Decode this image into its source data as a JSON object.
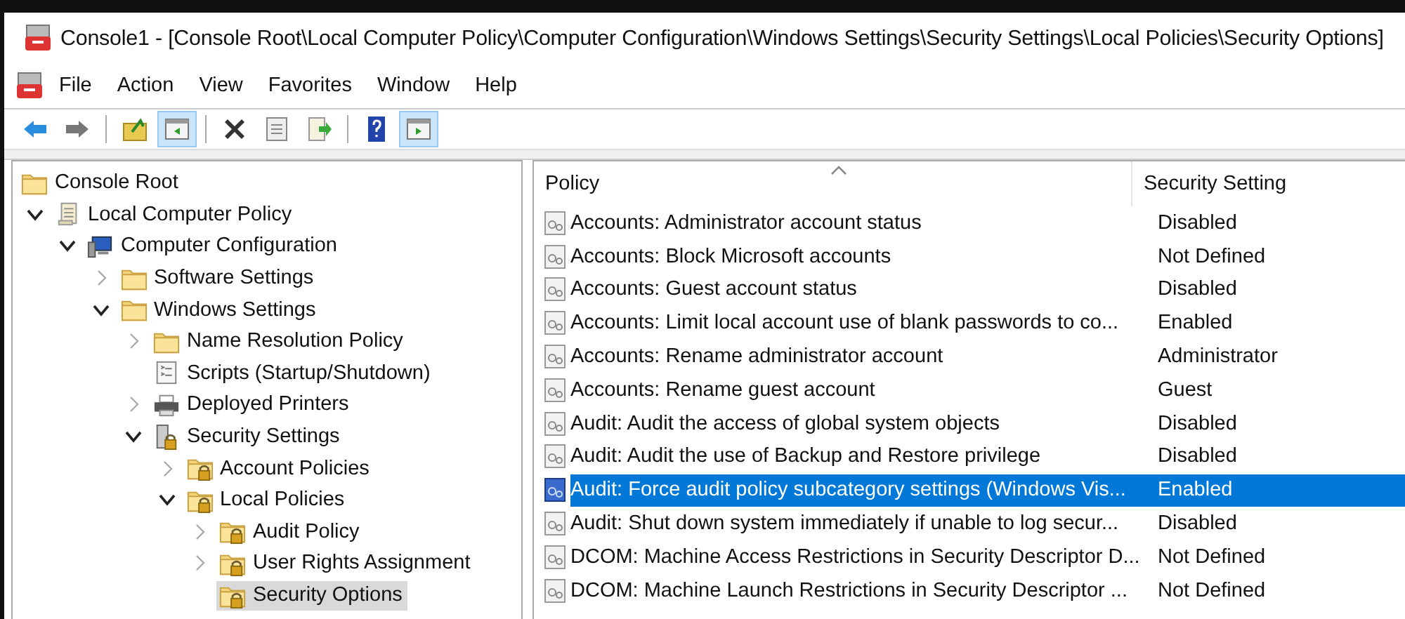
{
  "window": {
    "title": "Console1 - [Console Root\\Local Computer Policy\\Computer Configuration\\Windows Settings\\Security Settings\\Local Policies\\Security Options]"
  },
  "menu": [
    "File",
    "Action",
    "View",
    "Favorites",
    "Window",
    "Help"
  ],
  "toolbar": [
    {
      "kind": "back",
      "pressed": false
    },
    {
      "kind": "forward",
      "pressed": false
    },
    {
      "kind": "sep"
    },
    {
      "kind": "up",
      "pressed": false
    },
    {
      "kind": "tree",
      "pressed": true
    },
    {
      "kind": "sep"
    },
    {
      "kind": "delete",
      "pressed": false
    },
    {
      "kind": "properties",
      "pressed": false
    },
    {
      "kind": "export",
      "pressed": false
    },
    {
      "kind": "sep"
    },
    {
      "kind": "help",
      "pressed": false
    },
    {
      "kind": "actionpane",
      "pressed": true
    }
  ],
  "tree": [
    {
      "label": "Console Root",
      "kind": "folder",
      "selected": false,
      "children": [
        {
          "label": "Local Computer Policy",
          "kind": "scroll",
          "expandable": true,
          "expanded": true,
          "selected": false,
          "children": [
            {
              "label": "Computer Configuration",
              "kind": "computer",
              "expandable": true,
              "expanded": true,
              "selected": false,
              "children": [
                {
                  "label": "Software Settings",
                  "kind": "folder",
                  "expandable": true,
                  "expanded": false,
                  "selected": false
                },
                {
                  "label": "Windows Settings",
                  "kind": "folder",
                  "expandable": true,
                  "expanded": true,
                  "selected": false,
                  "children": [
                    {
                      "label": "Name Resolution Policy",
                      "kind": "folder",
                      "expandable": true,
                      "expanded": false,
                      "selected": false
                    },
                    {
                      "label": "Scripts (Startup/Shutdown)",
                      "kind": "script",
                      "selected": false
                    },
                    {
                      "label": "Deployed Printers",
                      "kind": "printer",
                      "expandable": true,
                      "expanded": false,
                      "selected": false
                    },
                    {
                      "label": "Security Settings",
                      "kind": "security",
                      "expandable": true,
                      "expanded": true,
                      "selected": false,
                      "children": [
                        {
                          "label": "Account Policies",
                          "kind": "lockfolder",
                          "expandable": true,
                          "expanded": false,
                          "selected": false
                        },
                        {
                          "label": "Local Policies",
                          "kind": "lockfolder",
                          "expandable": true,
                          "expanded": true,
                          "selected": false,
                          "children": [
                            {
                              "label": "Audit Policy",
                              "kind": "lockfolder",
                              "expandable": true,
                              "expanded": false,
                              "selected": false
                            },
                            {
                              "label": "User Rights Assignment",
                              "kind": "lockfolder",
                              "expandable": true,
                              "expanded": false,
                              "selected": false
                            },
                            {
                              "label": "Security Options",
                              "kind": "lockfolder",
                              "selected": true
                            }
                          ]
                        }
                      ]
                    }
                  ]
                }
              ]
            }
          ]
        }
      ]
    }
  ],
  "table": {
    "columns": [
      "Policy",
      "Security Setting"
    ],
    "rows": [
      {
        "policy": "Accounts: Administrator account status",
        "setting": "Disabled",
        "selected": false
      },
      {
        "policy": "Accounts: Block Microsoft accounts",
        "setting": "Not Defined",
        "selected": false
      },
      {
        "policy": "Accounts: Guest account status",
        "setting": "Disabled",
        "selected": false
      },
      {
        "policy": "Accounts: Limit local account use of blank passwords to co...",
        "setting": "Enabled",
        "selected": false
      },
      {
        "policy": "Accounts: Rename administrator account",
        "setting": "Administrator",
        "selected": false
      },
      {
        "policy": "Accounts: Rename guest account",
        "setting": "Guest",
        "selected": false
      },
      {
        "policy": "Audit: Audit the access of global system objects",
        "setting": "Disabled",
        "selected": false
      },
      {
        "policy": "Audit: Audit the use of Backup and Restore privilege",
        "setting": "Disabled",
        "selected": false
      },
      {
        "policy": "Audit: Force audit policy subcategory settings (Windows Vis...",
        "setting": "Enabled",
        "selected": true
      },
      {
        "policy": "Audit: Shut down system immediately if unable to log secur...",
        "setting": "Disabled",
        "selected": false
      },
      {
        "policy": "DCOM: Machine Access Restrictions in Security Descriptor D...",
        "setting": "Not Defined",
        "selected": false
      },
      {
        "policy": "DCOM: Machine Launch Restrictions in Security Descriptor ...",
        "setting": "Not Defined",
        "selected": false
      }
    ]
  }
}
